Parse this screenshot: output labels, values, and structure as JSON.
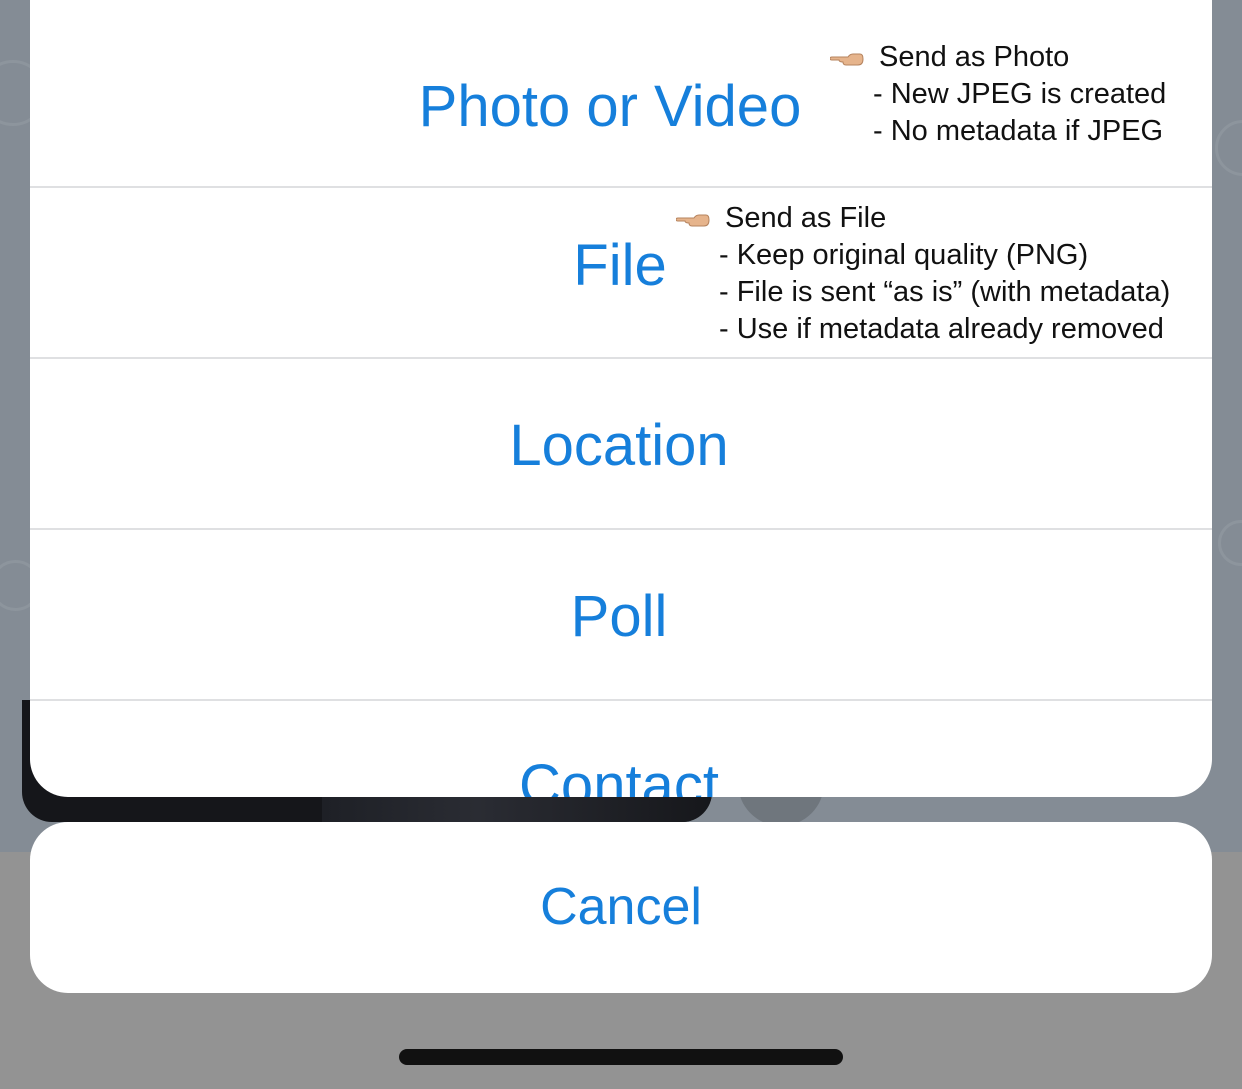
{
  "action_sheet": {
    "options": [
      {
        "label": "Photo or Video"
      },
      {
        "label": "File"
      },
      {
        "label": "Location"
      },
      {
        "label": "Poll"
      },
      {
        "label": "Contact"
      }
    ],
    "cancel_label": "Cancel"
  },
  "annotations": {
    "photo_note": {
      "title": "Send as Photo",
      "lines": [
        "- New JPEG is created",
        "- No metadata if JPEG"
      ]
    },
    "file_note": {
      "title": "Send as File",
      "lines": [
        "- Keep original quality (PNG)",
        "- File is sent “as is” (with metadata)",
        "- Use if metadata already removed"
      ]
    }
  },
  "colors": {
    "accent": "#167fdb",
    "sheet_background": "#ffffff",
    "dimmed_background": "#848c95",
    "separator": "#dfe0e2"
  },
  "icons": [
    "pointing-hand-icon"
  ]
}
